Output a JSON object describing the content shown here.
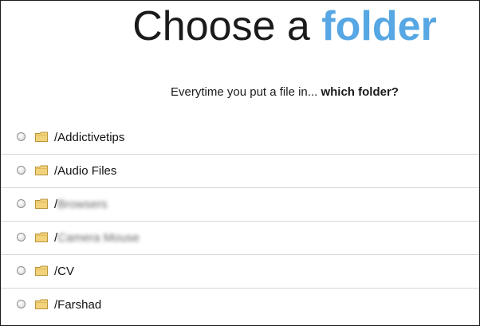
{
  "header": {
    "title_main": "Choose a ",
    "title_accent": "folder",
    "subtitle_prefix": "Everytime you put a file in... ",
    "subtitle_bold": "which folder?"
  },
  "colors": {
    "accent": "#56a7e3",
    "folder_icon": "#f2d27a"
  },
  "folders": [
    {
      "label": "/Addictivetips",
      "blurred": false
    },
    {
      "label": "/Audio Files",
      "blurred": false
    },
    {
      "label_prefix": "/",
      "label_blurred": "Browsers",
      "blurred": true
    },
    {
      "label_prefix": "/",
      "label_blurred": "Camera Mouse",
      "blurred": true
    },
    {
      "label": "/CV",
      "blurred": false
    },
    {
      "label": "/Farshad",
      "blurred": false
    }
  ],
  "icons": {
    "radio": "radio-icon",
    "folder": "folder-icon"
  }
}
